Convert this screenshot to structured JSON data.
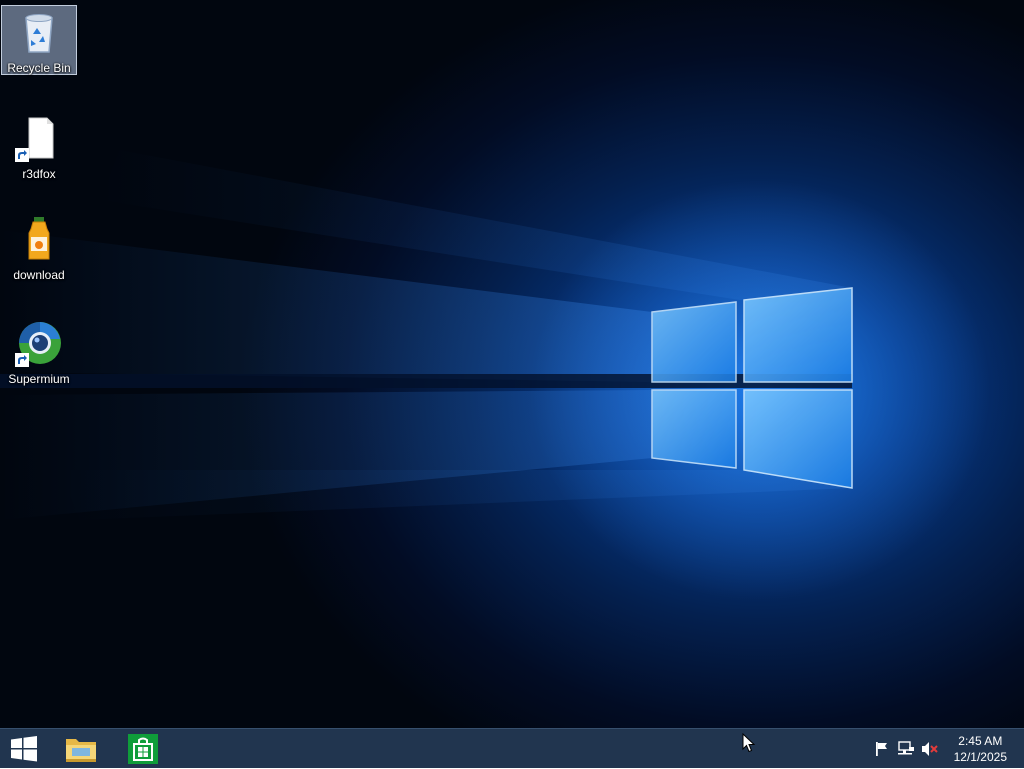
{
  "desktop": {
    "icons": [
      {
        "label": "Recycle Bin",
        "icon": "recycle-bin-icon",
        "selected": true
      },
      {
        "label": "r3dfox",
        "icon": "document-icon",
        "shortcut": true
      },
      {
        "label": "download",
        "icon": "juice-bottle-icon",
        "shortcut": false
      },
      {
        "label": "Supermium",
        "icon": "supermium-browser-icon",
        "shortcut": true
      }
    ]
  },
  "taskbar": {
    "start_icon": "windows-logo-icon",
    "pinned": [
      {
        "name": "File Explorer",
        "icon": "folder-icon"
      },
      {
        "name": "Store",
        "icon": "store-icon"
      }
    ],
    "tray": [
      "action-center-flag-icon",
      "network-icon",
      "volume-muted-icon"
    ],
    "clock": {
      "time": "2:45 AM",
      "date": "12/1/2025"
    }
  },
  "colors": {
    "taskbar": "#21354f",
    "accent": "#0a5fc4",
    "store_green": "#0f9d3a"
  }
}
